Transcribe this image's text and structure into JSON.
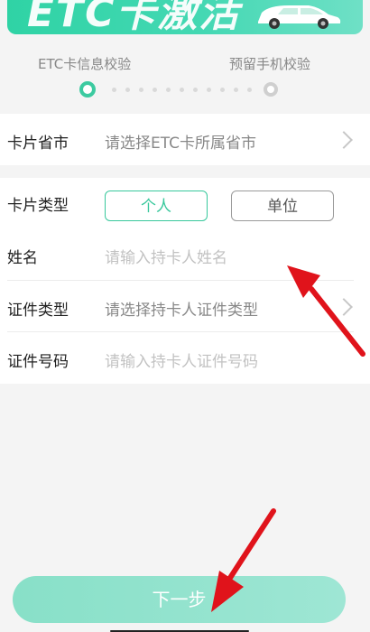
{
  "banner": {
    "title": "ETC卡激活"
  },
  "steps": [
    {
      "label": "ETC卡信息校验",
      "active": true
    },
    {
      "label": "预留手机校验",
      "active": false
    }
  ],
  "province": {
    "label": "卡片省市",
    "placeholder": "请选择ETC卡所属省市"
  },
  "card_type": {
    "label": "卡片类型",
    "options": [
      "个人",
      "单位"
    ],
    "selected": "个人"
  },
  "name": {
    "label": "姓名",
    "placeholder": "请输入持卡人姓名"
  },
  "id_type": {
    "label": "证件类型",
    "placeholder": "请选择持卡人证件类型"
  },
  "id_number": {
    "label": "证件号码",
    "placeholder": "请输入持卡人证件号码"
  },
  "next_button": {
    "label": "下一步"
  },
  "colors": {
    "accent": "#3ccaa0",
    "button": "#9ee6d4",
    "annotation_arrow": "#e0131b"
  }
}
